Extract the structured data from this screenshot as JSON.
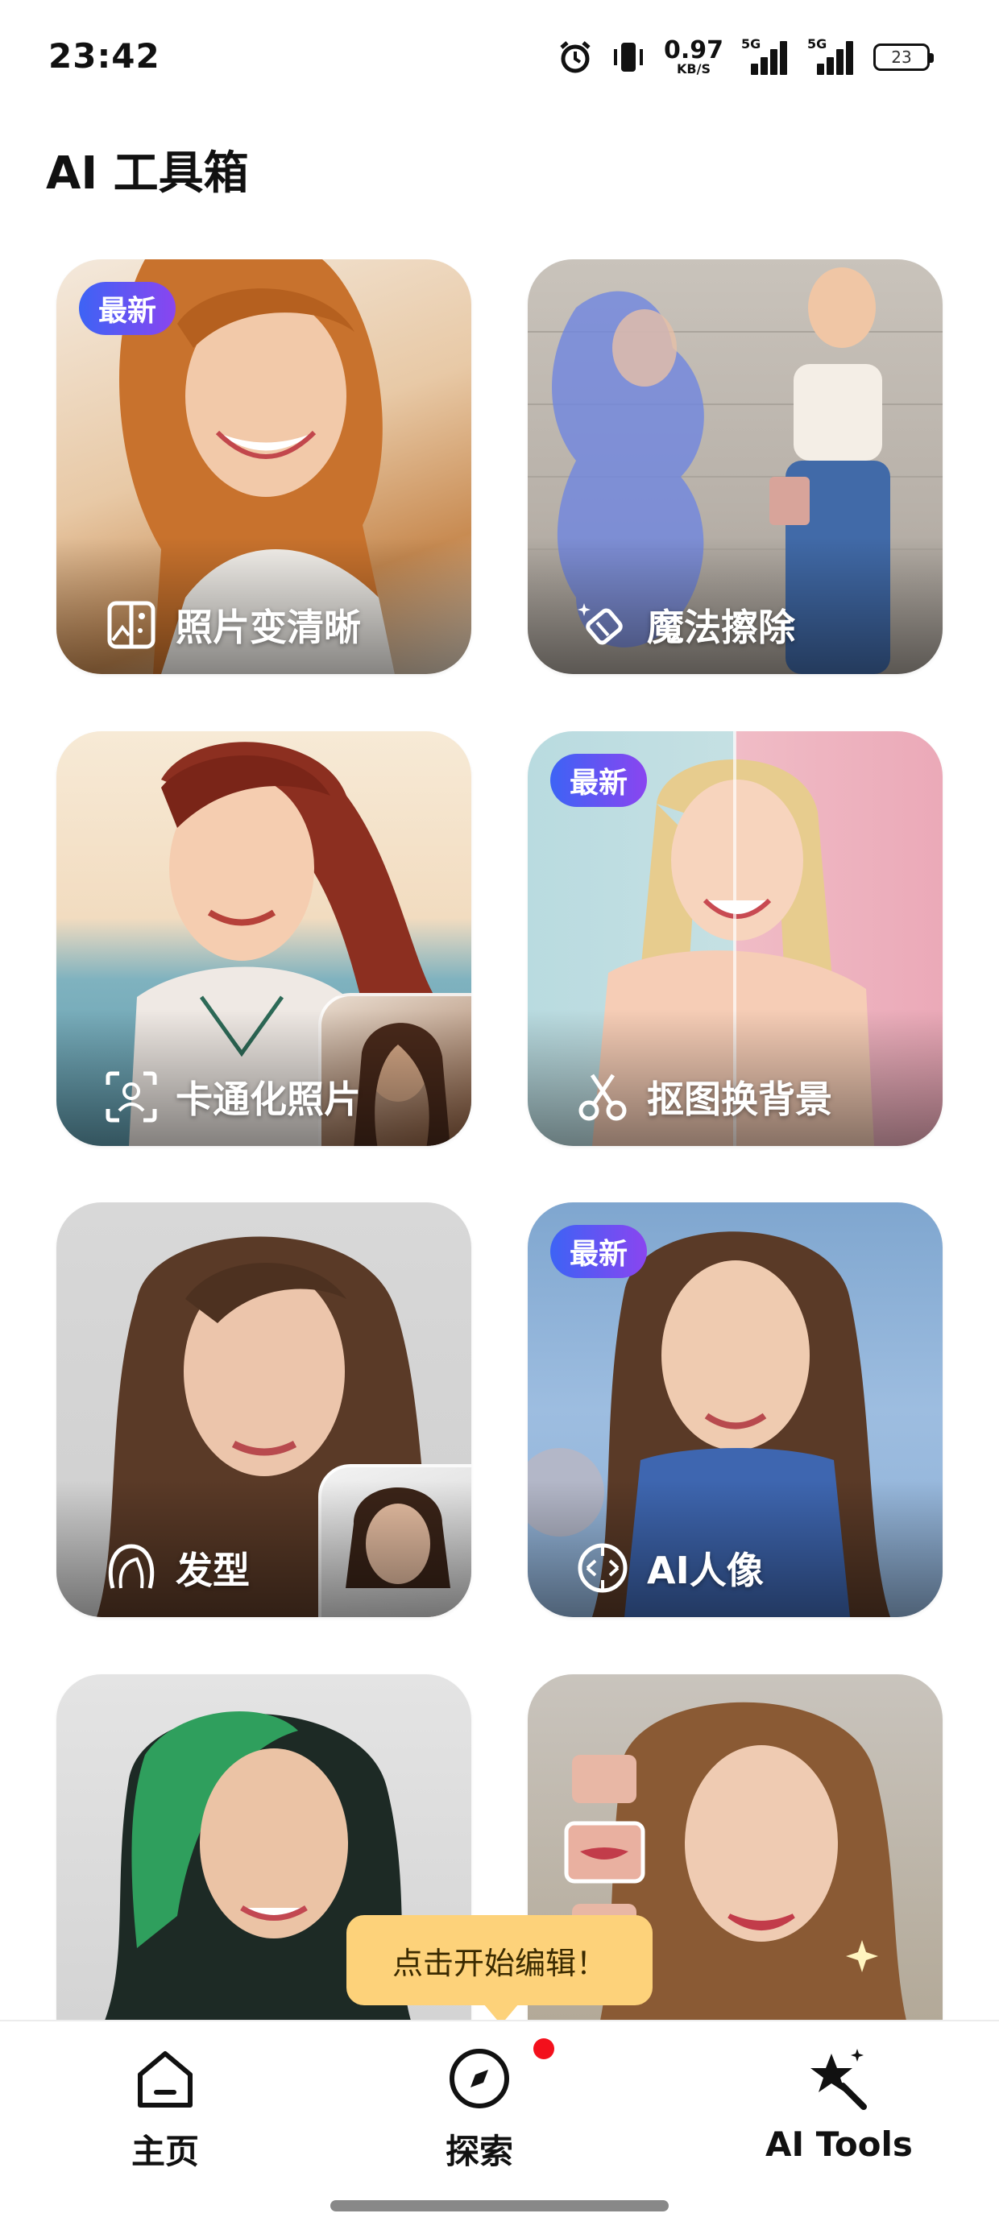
{
  "status_bar": {
    "time": "23:42",
    "net_speed_value": "0.97",
    "net_speed_unit": "KB/S",
    "signal1_label": "5G",
    "signal2_label": "5G",
    "battery": "23",
    "icons": [
      "alarm-icon",
      "vibrate-icon",
      "signal-icon",
      "battery-icon"
    ]
  },
  "header": {
    "title": "AI 工具箱"
  },
  "tools": [
    {
      "label": "照片变清晰",
      "badge": "最新",
      "icon": "image-enhance-icon"
    },
    {
      "label": "魔法擦除",
      "badge": "",
      "icon": "magic-eraser-icon"
    },
    {
      "label": "卡通化照片",
      "badge": "",
      "icon": "face-scan-icon"
    },
    {
      "label": "抠图换背景",
      "badge": "最新",
      "icon": "scissors-icon"
    },
    {
      "label": "发型",
      "badge": "",
      "icon": "hair-icon"
    },
    {
      "label": "AI人像",
      "badge": "最新",
      "icon": "ai-portrait-icon"
    }
  ],
  "tooltip": {
    "text": "点击开始编辑！"
  },
  "bottom_nav": {
    "items": [
      {
        "label": "主页",
        "icon": "home-icon"
      },
      {
        "label": "探索",
        "icon": "compass-icon"
      },
      {
        "label": "AI Tools",
        "icon": "magic-wand-icon"
      }
    ]
  },
  "colors": {
    "badge_gradient_start": "#3d63f5",
    "badge_gradient_end": "#8a45f0",
    "tooltip_bg": "#fdd27a",
    "notification_dot": "#f3101c"
  }
}
